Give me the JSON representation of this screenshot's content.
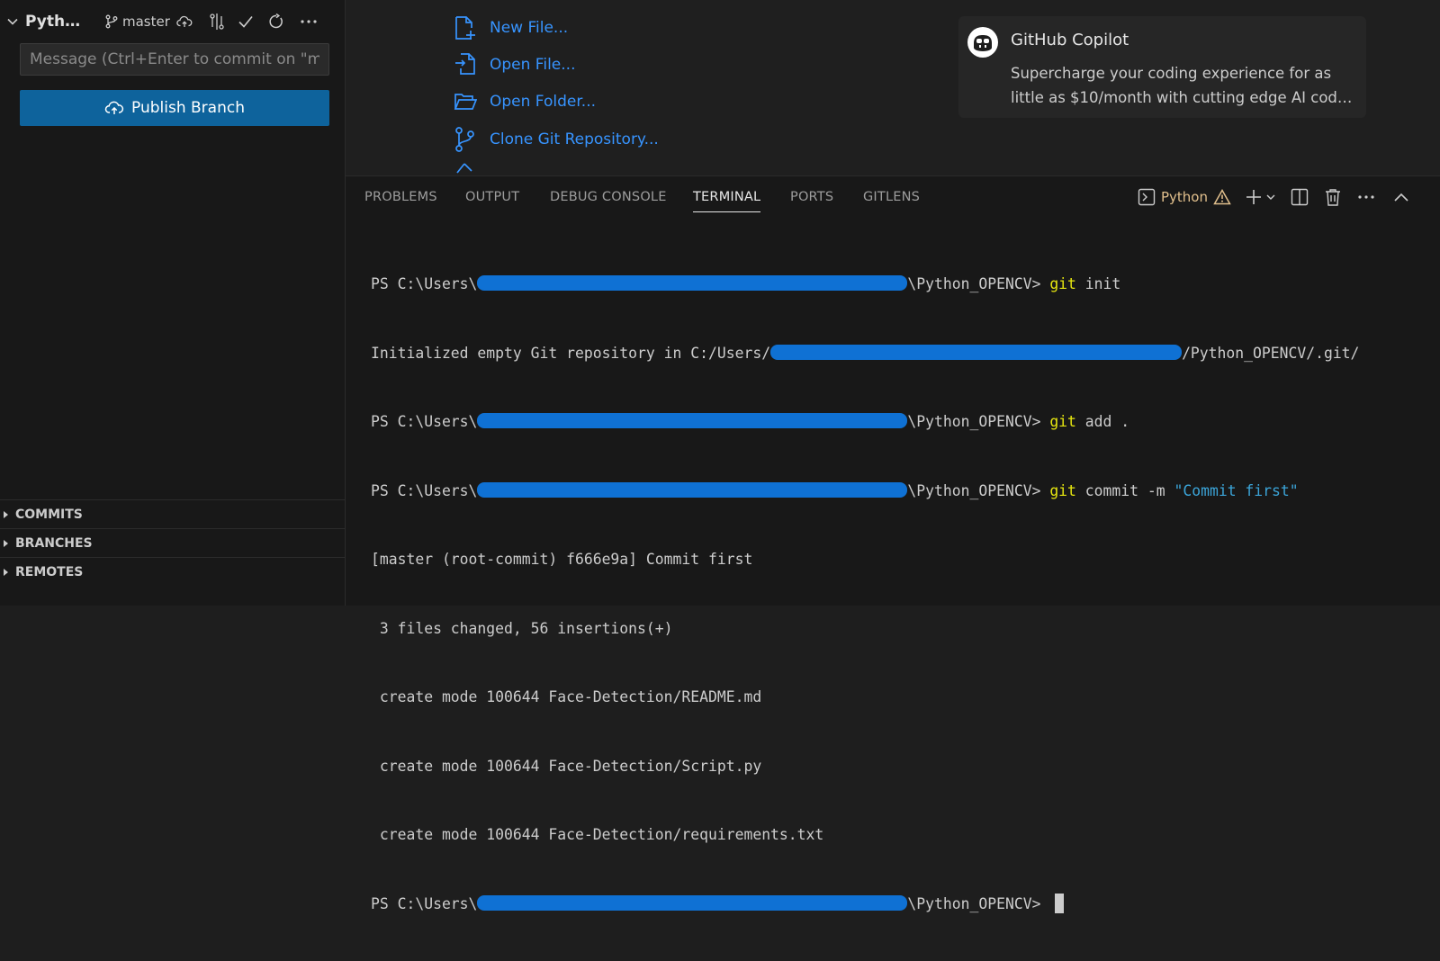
{
  "sidebar": {
    "repo_name": "Python_OPENCV",
    "branch": "master",
    "commit_placeholder": "Message (Ctrl+Enter to commit on \"master\")",
    "publish_label": "Publish Branch",
    "sections": [
      {
        "label": "COMMITS"
      },
      {
        "label": "BRANCHES"
      },
      {
        "label": "REMOTES"
      }
    ]
  },
  "welcome": {
    "start": [
      {
        "label": "New File...",
        "icon": "new-file-icon"
      },
      {
        "label": "Open File...",
        "icon": "open-file-icon"
      },
      {
        "label": "Open Folder...",
        "icon": "open-folder-icon"
      },
      {
        "label": "Clone Git Repository...",
        "icon": "git-clone-icon"
      }
    ],
    "copilot": {
      "title": "GitHub Copilot",
      "description": "Supercharge your coding experience for as little as $10/month with cutting edge AI code completion."
    }
  },
  "panel": {
    "tabs": [
      {
        "label": "PROBLEMS",
        "active": false
      },
      {
        "label": "OUTPUT",
        "active": false
      },
      {
        "label": "DEBUG CONSOLE",
        "active": false
      },
      {
        "label": "TERMINAL",
        "active": true
      },
      {
        "label": "PORTS",
        "active": false
      },
      {
        "label": "GITLENS",
        "active": false
      }
    ],
    "terminal_profile": "Python"
  },
  "terminal": {
    "prompt_prefix": "PS C:\\Users\\",
    "prompt_suffix": "\\Python_OPENCV> ",
    "cmd_git": "git",
    "cmd1_args": " init",
    "line2_prefix": "Initialized empty Git repository in C:/Users/",
    "line2_suffix": "/Python_OPENCV/.git/",
    "cmd2_args": " add .",
    "cmd3_args": " commit -m ",
    "cmd3_string": "\"Commit first\"",
    "output": [
      "[master (root-commit) f666e9a] Commit first",
      " 3 files changed, 56 insertions(+)",
      " create mode 100644 Face-Detection/README.md",
      " create mode 100644 Face-Detection/Script.py",
      " create mode 100644 Face-Detection/requirements.txt"
    ]
  },
  "colors": {
    "accent": "#0e639c",
    "link": "#3794ff",
    "command": "#e5e510",
    "string": "#3ba4d8",
    "redaction": "#0f71d4"
  }
}
